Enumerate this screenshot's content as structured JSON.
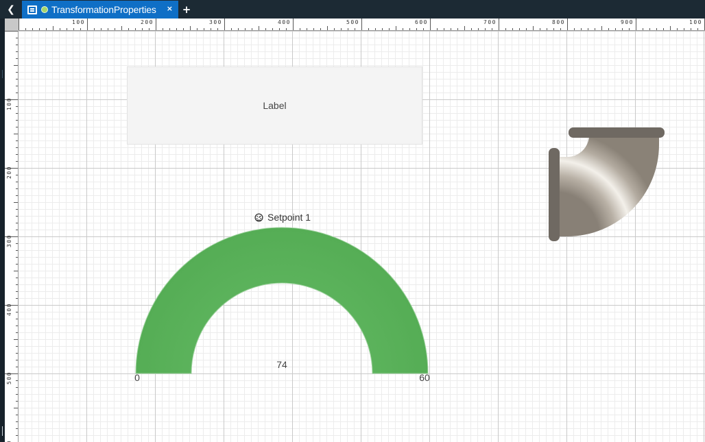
{
  "tabbar": {
    "tab_title": "TransformationProperties",
    "close_label": "×",
    "add_label": "+",
    "back_label": "❮",
    "active_color": "#0f6fc6",
    "status_color": "#a5d66b"
  },
  "rulers": {
    "top_labels": [
      "100",
      "200",
      "300",
      "400",
      "500",
      "600",
      "700",
      "800",
      "900",
      "100"
    ],
    "left_labels": [
      "100",
      "200",
      "300",
      "400",
      "500",
      "0"
    ]
  },
  "label_component": {
    "text": "Label"
  },
  "gauge": {
    "title": "Setpoint 1",
    "icon": "gauge-icon",
    "value": "74",
    "min": "0",
    "max": "60",
    "fill_color": "#5cb35c"
  },
  "pipe": {
    "icon": "pipe-elbow-icon"
  }
}
